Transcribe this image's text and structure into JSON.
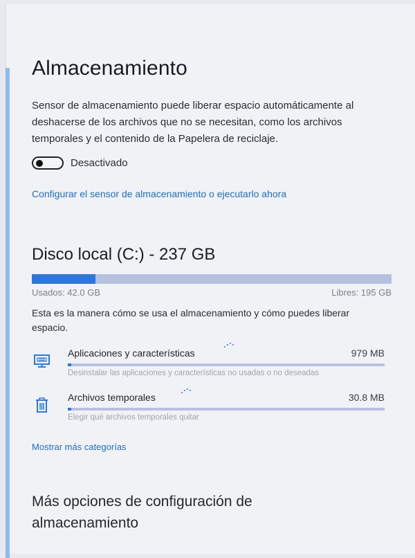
{
  "storage": {
    "title": "Almacenamiento",
    "description": "Sensor de almacenamiento puede liberar espacio automáticamente al deshacerse de los archivos que no se necesitan, como los archivos temporales y el contenido de la Papelera de reciclaje.",
    "toggle": {
      "state": "off",
      "label": "Desactivado"
    },
    "configure_link": "Configurar el sensor de almacenamiento o ejecutarlo ahora"
  },
  "disk": {
    "title": "Disco local (C:) - 237 GB",
    "used_label": "Usados: 42.0 GB",
    "free_label": "Libres: 195 GB",
    "used_fraction": 0.177,
    "intro": "Esta es la manera cómo se usa el almacenamiento y cómo puedes liberar espacio."
  },
  "categories": [
    {
      "name": "Aplicaciones y características",
      "size": "979 MB",
      "fraction": 0.008,
      "description": "Desinstalar las aplicaciones y características no usadas o no deseadas",
      "icon": "apps-features-icon"
    },
    {
      "name": "Archivos temporales",
      "size": "30.8 MB",
      "fraction": 0.001,
      "description": "Elegir qué archivos temporales quitar",
      "icon": "trash-icon"
    }
  ],
  "more_categories_link": "Mostrar más categorías",
  "more_options_title": "Más opciones de configuración de almacenamiento",
  "colors": {
    "accent": "#2d78d7",
    "bar_track": "#b8c0df",
    "link": "#1f6db8"
  }
}
